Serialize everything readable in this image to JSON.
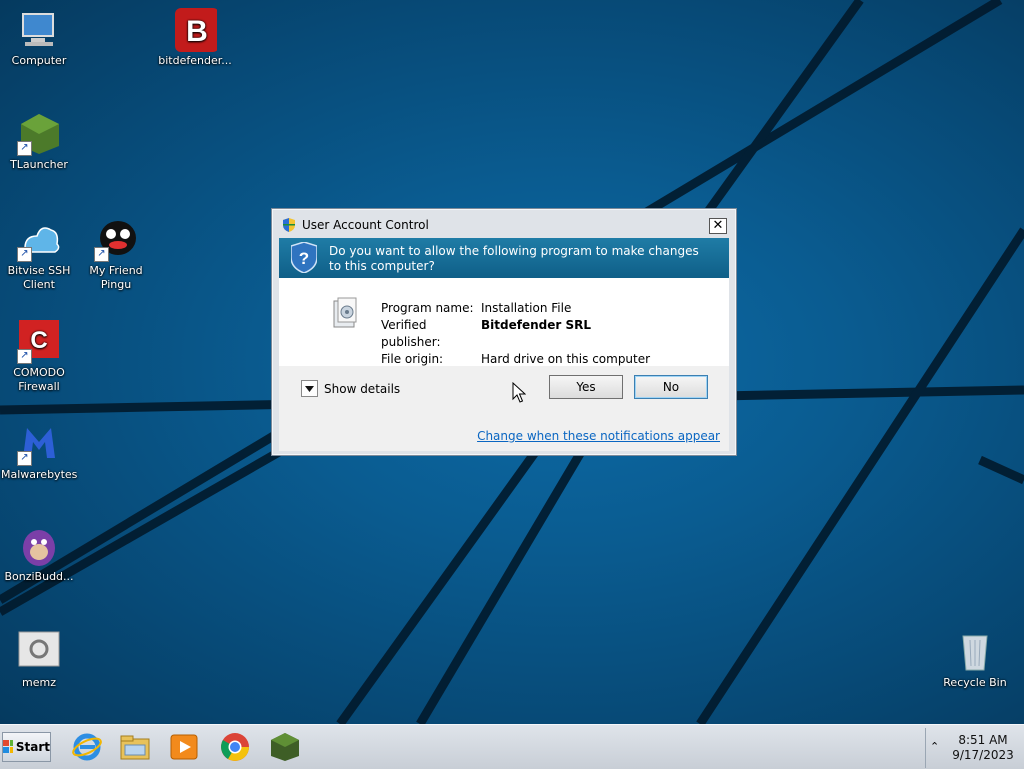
{
  "desktop": {
    "icons": [
      {
        "label": "Computer",
        "icon": "computer-icon"
      },
      {
        "label": "bitdefender...",
        "icon": "bitdefender-icon"
      },
      {
        "label": "TLauncher",
        "icon": "tlauncher-icon"
      },
      {
        "label": "Bitvise SSH Client",
        "icon": "bitvise-icon"
      },
      {
        "label": "My Friend Pingu",
        "icon": "pingu-icon"
      },
      {
        "label": "COMODO Firewall",
        "icon": "comodo-icon"
      },
      {
        "label": "Malwarebytes",
        "icon": "malwarebytes-icon"
      },
      {
        "label": "BonziBudd...",
        "icon": "bonzibuddy-icon"
      },
      {
        "label": "memz",
        "icon": "memz-icon"
      },
      {
        "label": "Recycle Bin",
        "icon": "recycle-bin-icon"
      }
    ]
  },
  "uac": {
    "title": "User Account Control",
    "question": "Do you want to allow the following program to make changes to this computer?",
    "fields": [
      {
        "label": "Program name:",
        "value": "Installation File"
      },
      {
        "label": "Verified publisher:",
        "value": "Bitdefender SRL"
      },
      {
        "label": "File origin:",
        "value": "Hard drive on this computer"
      }
    ],
    "show_details": "Show details",
    "yes_label": "Yes",
    "no_label": "No",
    "change_link": "Change when these notifications appear",
    "banner_color": "#16709b"
  },
  "taskbar": {
    "start_label": "Start",
    "pinned": [
      "internet-explorer-icon",
      "file-explorer-icon",
      "media-player-icon",
      "chrome-icon",
      "minecraft-icon"
    ],
    "time": "8:51 AM",
    "date": "9/17/2023"
  }
}
